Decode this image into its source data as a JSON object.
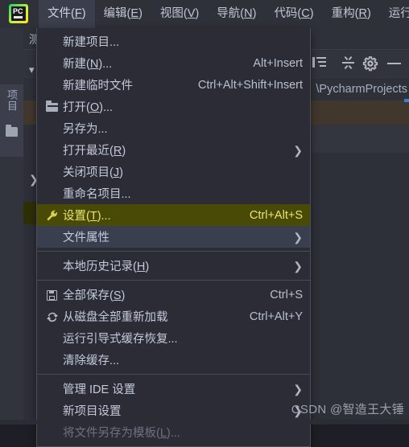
{
  "app": {
    "logo_text": "PC",
    "window_title": "测试项"
  },
  "menubar": {
    "items": [
      {
        "label": "文件(F)",
        "mnemonic": "F",
        "active": true
      },
      {
        "label": "编辑(E)",
        "mnemonic": "E",
        "active": false
      },
      {
        "label": "视图(V)",
        "mnemonic": "V",
        "active": false
      },
      {
        "label": "导航(N)",
        "mnemonic": "N",
        "active": false
      },
      {
        "label": "代码(C)",
        "mnemonic": "C",
        "active": false
      },
      {
        "label": "重构(R)",
        "mnemonic": "R",
        "active": false
      },
      {
        "label": "运行(U)",
        "mnemonic": "U",
        "active": false
      }
    ]
  },
  "project_panel": {
    "tool_tab_label": "项目",
    "path_text": "\\PycharmProjects",
    "toolbar_icons": [
      "expand-all-icon",
      "collapse-all-icon",
      "gear-icon",
      "minimize-icon"
    ]
  },
  "file_menu": {
    "items": [
      {
        "label": "新建项目...",
        "shortcut": "",
        "icon": "",
        "arrow": false,
        "state": "normal"
      },
      {
        "label": "新建(N)...",
        "mnemonic": "N",
        "shortcut": "Alt+Insert",
        "icon": "",
        "arrow": false,
        "state": "normal"
      },
      {
        "label": "新建临时文件",
        "shortcut": "Ctrl+Alt+Shift+Insert",
        "icon": "",
        "arrow": false,
        "state": "normal"
      },
      {
        "label": "打开(O)...",
        "mnemonic": "O",
        "shortcut": "",
        "icon": "folder-icon",
        "arrow": false,
        "state": "normal"
      },
      {
        "label": "另存为...",
        "shortcut": "",
        "icon": "",
        "arrow": false,
        "state": "normal"
      },
      {
        "label": "打开最近(R)",
        "mnemonic": "R",
        "shortcut": "",
        "icon": "",
        "arrow": true,
        "state": "normal"
      },
      {
        "label": "关闭项目(J)",
        "mnemonic": "J",
        "shortcut": "",
        "icon": "",
        "arrow": false,
        "state": "normal"
      },
      {
        "label": "重命名项目...",
        "shortcut": "",
        "icon": "",
        "arrow": false,
        "state": "normal"
      },
      {
        "label": "设置(T)...",
        "mnemonic": "T",
        "shortcut": "Ctrl+Alt+S",
        "icon": "wrench-icon",
        "arrow": false,
        "state": "selected"
      },
      {
        "label": "文件属性",
        "shortcut": "",
        "icon": "",
        "arrow": true,
        "state": "hovered"
      },
      {
        "separator": true
      },
      {
        "label": "本地历史记录(H)",
        "mnemonic": "H",
        "shortcut": "",
        "icon": "",
        "arrow": true,
        "state": "normal"
      },
      {
        "separator": true
      },
      {
        "label": "全部保存(S)",
        "mnemonic": "S",
        "shortcut": "Ctrl+S",
        "icon": "save-icon",
        "arrow": false,
        "state": "normal"
      },
      {
        "label": "从磁盘全部重新加载",
        "shortcut": "Ctrl+Alt+Y",
        "icon": "reload-icon",
        "arrow": false,
        "state": "normal"
      },
      {
        "label": "运行引导式缓存恢复...",
        "shortcut": "",
        "icon": "",
        "arrow": false,
        "state": "normal"
      },
      {
        "label": "清除缓存...",
        "shortcut": "",
        "icon": "",
        "arrow": false,
        "state": "normal"
      },
      {
        "separator": true
      },
      {
        "label": "管理 IDE 设置",
        "shortcut": "",
        "icon": "",
        "arrow": true,
        "state": "normal"
      },
      {
        "label": "新项目设置",
        "shortcut": "",
        "icon": "",
        "arrow": true,
        "state": "normal"
      },
      {
        "label": "将文件另存为模板(L)...",
        "mnemonic": "L",
        "shortcut": "",
        "icon": "",
        "arrow": false,
        "state": "disabled"
      }
    ]
  },
  "watermark": {
    "text": "CSDN @智造王大锤"
  },
  "colors": {
    "menu_background": "#2b2c36",
    "menu_selected": "#4a4a07",
    "menu_selected_text": "#e8e56f",
    "menu_hovered": "#3a3f50",
    "text": "#c3cadb",
    "disabled_text": "#6d727e",
    "accent_logo": "#cdf23f"
  }
}
